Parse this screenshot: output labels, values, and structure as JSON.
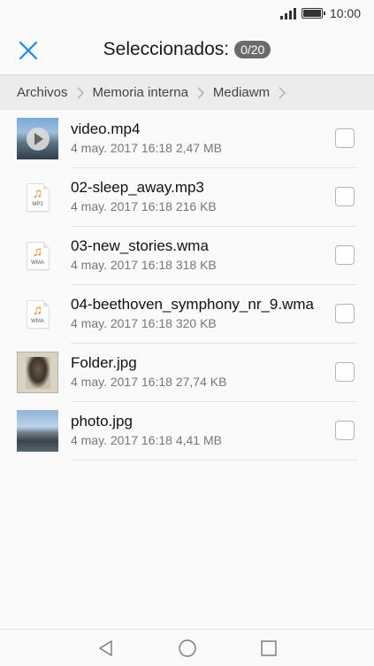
{
  "status_bar": {
    "time": "10:00",
    "signal_icon": "signal-icon",
    "battery_icon": "battery-icon"
  },
  "header": {
    "close_icon": "close-icon",
    "title": "Seleccionados:",
    "counter": "0/20",
    "accent_color": "#1e88e5"
  },
  "breadcrumb": {
    "items": [
      "Archivos",
      "Memoria interna",
      "Mediawm"
    ]
  },
  "files": [
    {
      "name": "video.mp4",
      "meta": "4 may. 2017 16:18 2,47 MB",
      "thumb": "video-thumbnail"
    },
    {
      "name": "02-sleep_away.mp3",
      "meta": "4 may. 2017 16:18 216 KB",
      "thumb": "mp3-file-icon",
      "ext": "MP3"
    },
    {
      "name": "03-new_stories.wma",
      "meta": "4 may. 2017 16:18 318 KB",
      "thumb": "wma-file-icon",
      "ext": "WMA"
    },
    {
      "name": "04-beethoven_symphony_nr_9.wma",
      "meta": "4 may. 2017 16:18 320 KB",
      "thumb": "wma-file-icon",
      "ext": "WMA"
    },
    {
      "name": "Folder.jpg",
      "meta": "4 may. 2017 16:18 27,74 KB",
      "thumb": "image-thumbnail"
    },
    {
      "name": "photo.jpg",
      "meta": "4 may. 2017 16:18 4,41 MB",
      "thumb": "image-thumbnail"
    }
  ],
  "nav_bar": {
    "back_icon": "back-triangle-icon",
    "home_icon": "home-circle-icon",
    "recents_icon": "recents-square-icon"
  }
}
